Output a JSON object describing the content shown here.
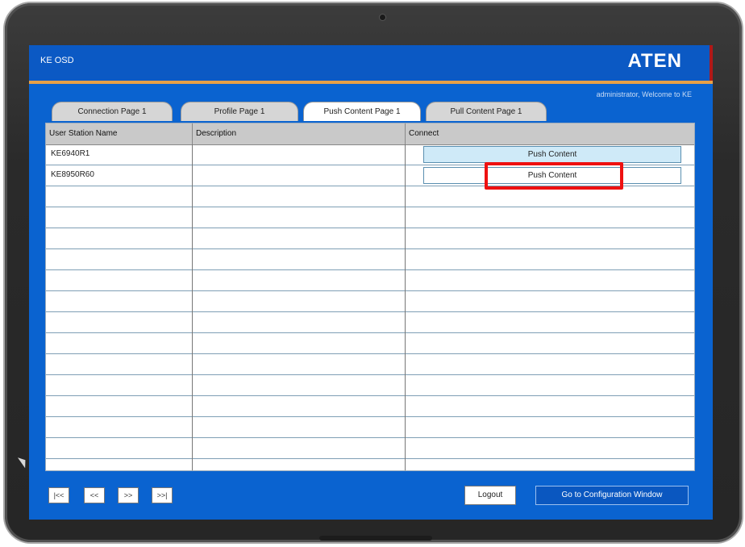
{
  "app": {
    "title": "KE OSD",
    "logo": "ATEN",
    "welcome": "administrator, Welcome to KE"
  },
  "tabs": [
    {
      "label": "Connection Page 1",
      "active": false
    },
    {
      "label": "Profile Page 1",
      "active": false
    },
    {
      "label": "Push Content Page 1",
      "active": true
    },
    {
      "label": "Pull Content Page 1",
      "active": false
    }
  ],
  "table": {
    "headers": [
      "User Station Name",
      "Description",
      "Connect"
    ],
    "rows": [
      {
        "name": "KE6940R1",
        "description": "",
        "action": "Push Content"
      },
      {
        "name": "KE8950R60",
        "description": "",
        "action": "Push Content"
      }
    ]
  },
  "pager": [
    "|<<",
    "<<",
    ">>",
    ">>|"
  ],
  "footer": {
    "logout": "Logout",
    "config": "Go to Configuration Window"
  },
  "colors": {
    "titlebar": "#0b59c4",
    "accent_line": "#e7a046",
    "highlight_box": "#ee1111"
  }
}
